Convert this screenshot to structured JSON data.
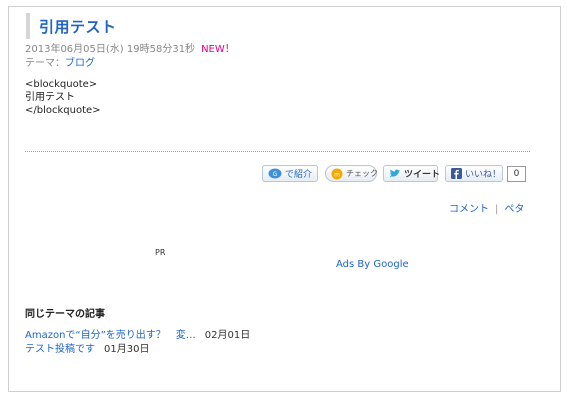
{
  "post": {
    "title": "引用テスト",
    "datetime": "2013年06月05日(水) 19時58分31秒",
    "new_label": "NEW！",
    "theme_prefix": "テーマ：",
    "theme_link": "ブログ",
    "body_lines": [
      "<blockquote>",
      "引用テスト",
      "</blockquote>"
    ]
  },
  "social": {
    "shokai_label": "で紹介",
    "check_label": "チェック",
    "tweet_label": "ツイート",
    "like_label": "いいね！",
    "like_count": "0"
  },
  "actions": {
    "comment": "コメント",
    "separator": "|",
    "peta": "ペタ"
  },
  "ads": {
    "pr": "PR",
    "ads_by_google": "Ads By Google"
  },
  "related": {
    "heading": "同じテーマの記事",
    "items": [
      {
        "title": "Amazonで“自分”を売り出す？　変…",
        "date": "02月01日"
      },
      {
        "title": "テスト投稿です",
        "date": "01月30日"
      }
    ]
  },
  "colors": {
    "link": "#1e64c8",
    "new_badge": "#e4007f",
    "meta_text": "#888888"
  }
}
